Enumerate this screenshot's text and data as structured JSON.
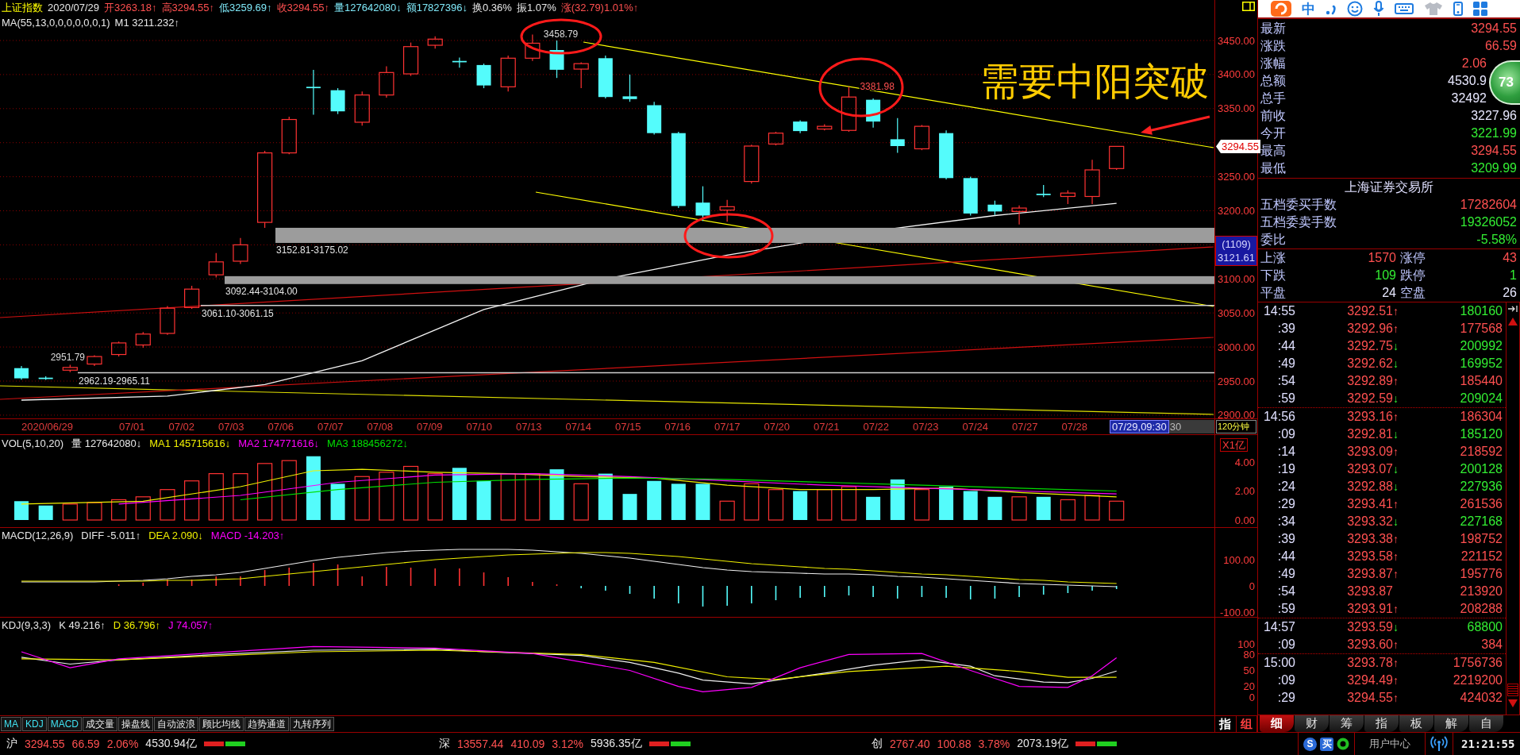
{
  "header": {
    "items": [
      {
        "text": "上证指数",
        "color": "#ffff00"
      },
      {
        "text": "2020/07/29",
        "color": "#e8e8e8"
      },
      {
        "text": "开3263.18↑",
        "color": "#ff5050"
      },
      {
        "text": "高3294.55↑",
        "color": "#ff5050"
      },
      {
        "text": "低3259.69↑",
        "color": "#7fe8f8"
      },
      {
        "text": "收3294.55↑",
        "color": "#ff5050"
      },
      {
        "text": "量127642080↓",
        "color": "#7fe8f8"
      },
      {
        "text": "额17827396↓",
        "color": "#7fe8f8"
      },
      {
        "text": "换0.36%",
        "color": "#e8e8e8"
      },
      {
        "text": "振1.07%",
        "color": "#e8e8e8"
      },
      {
        "text": "涨(32.79)1.01%↑",
        "color": "#ff5050"
      }
    ]
  },
  "main": {
    "indicator": [
      {
        "text": "MA(55,13,0,0,0,0,0,0,1)",
        "color": "#e8e8e8"
      },
      {
        "text": "M1 3211.232↑",
        "color": "#e8e8e8"
      }
    ],
    "levels": [
      {
        "kind": "zone",
        "label": "3152.81-3175.02"
      },
      {
        "kind": "zone",
        "label": "3092.44-3104.00"
      },
      {
        "kind": "line",
        "label": "3061.10-3061.15"
      },
      {
        "kind": "line",
        "label": "2962.19-2965.11"
      }
    ],
    "extremes": [
      {
        "kind": "high",
        "label": "3458.79",
        "color": "#dcdcdc"
      },
      {
        "kind": "high",
        "label": "3381.98",
        "color": "#ff5050"
      },
      {
        "kind": "low",
        "label": "2951.79",
        "color": "#dcdcdc"
      }
    ],
    "note": "需要中阳突破",
    "axis": {
      "ticks": [
        "3450.00",
        "3400.00",
        "3350.00",
        "3250.00",
        "3200.00",
        "3100.00",
        "3050.00",
        "3000.00",
        "2950.00",
        "2900.00"
      ],
      "price_tag": "3294.55",
      "cursor_count": "(1109)",
      "cursor_price": "3121.61"
    }
  },
  "date_axis": {
    "labels": [
      "2020/06/29",
      "07/01",
      "07/02",
      "07/03",
      "07/06",
      "07/07",
      "07/08",
      "07/09",
      "07/10",
      "07/13",
      "07/14",
      "07/15",
      "07/16",
      "07/17",
      "07/20",
      "07/21",
      "07/22",
      "07/23",
      "07/24",
      "07/27",
      "07/28"
    ],
    "cursor": "07/29,09:30",
    "cursor_tail": "30",
    "period": "120分钟"
  },
  "volume": {
    "indicator": [
      {
        "text": "VOL(5,10,20)",
        "color": "#e8e8e8"
      },
      {
        "text": "量 127642080↓",
        "color": "#e8e8e8"
      },
      {
        "text": "MA1 145715616↓",
        "color": "#f0f000"
      },
      {
        "text": "MA2 174771616↓",
        "color": "#ff00ff"
      },
      {
        "text": "MA3 188456272↓",
        "color": "#00e000"
      }
    ],
    "unit": "X1亿",
    "ticks": [
      "4.00",
      "2.00",
      "0.00"
    ]
  },
  "macd": {
    "indicator": [
      {
        "text": "MACD(12,26,9)",
        "color": "#e8e8e8"
      },
      {
        "text": "DIFF -5.011↑",
        "color": "#e8e8e8"
      },
      {
        "text": "DEA 2.090↓",
        "color": "#f0f000"
      },
      {
        "text": "MACD -14.203↑",
        "color": "#ff00ff"
      }
    ],
    "ticks": [
      "100.00",
      "0",
      "-100.00"
    ]
  },
  "kdj": {
    "indicator": [
      {
        "text": "KDJ(9,3,3)",
        "color": "#e8e8e8"
      },
      {
        "text": "K 49.216↑",
        "color": "#e8e8e8"
      },
      {
        "text": "D 36.796↑",
        "color": "#f0f000"
      },
      {
        "text": "J 74.057↑",
        "color": "#ff00ff"
      }
    ],
    "ticks": [
      "100",
      "80",
      "50",
      "20",
      "0"
    ]
  },
  "indicator_tabs": [
    {
      "label": "MA",
      "on": true
    },
    {
      "label": "KDJ",
      "on": true
    },
    {
      "label": "MACD",
      "on": true
    },
    {
      "label": "成交量",
      "on": false
    },
    {
      "label": "操盘线",
      "on": false
    },
    {
      "label": "自动波浪",
      "on": false
    },
    {
      "label": "顾比均线",
      "on": false
    },
    {
      "label": "趋势通道",
      "on": false
    },
    {
      "label": "九转序列",
      "on": false
    }
  ],
  "axis_buttons": [
    {
      "label": "指",
      "color": "#ffffff"
    },
    {
      "label": "组",
      "color": "#ff4040"
    }
  ],
  "input_toolbar": {
    "mode": "中"
  },
  "floating_ball": {
    "text": "73"
  },
  "quote": [
    {
      "label": "最新",
      "value": "3294.55",
      "color": "#ff5050"
    },
    {
      "label": "涨跌",
      "value": "66.59",
      "color": "#ff5050"
    },
    {
      "label": "涨幅",
      "value": "2.06",
      "color": "#ff5050"
    },
    {
      "label": "总额",
      "value": "4530.9",
      "color": "#e8e8ff"
    },
    {
      "label": "总手",
      "value": "32492",
      "color": "#e8e8ff"
    },
    {
      "label": "前收",
      "value": "3227.96",
      "color": "#e8e8ff"
    },
    {
      "label": "今开",
      "value": "3221.99",
      "color": "#33ee33"
    },
    {
      "label": "最高",
      "value": "3294.55",
      "color": "#ff5050"
    },
    {
      "label": "最低",
      "value": "3209.99",
      "color": "#33ee33"
    }
  ],
  "exchange": {
    "title": "上海证券交易所",
    "rows": [
      {
        "label": "五档委买手数",
        "value": "17282604",
        "color": "#ff5050"
      },
      {
        "label": "五档委卖手数",
        "value": "19326052",
        "color": "#33ee33"
      },
      {
        "label": "委比",
        "value": "-5.58%",
        "color": "#33ee33"
      }
    ]
  },
  "breadth": [
    {
      "label": "上涨",
      "count": "1570",
      "limit_label": "涨停",
      "limit_count": "43",
      "color": "#ff5050"
    },
    {
      "label": "下跌",
      "count": "109",
      "limit_label": "跌停",
      "limit_count": "1",
      "color": "#33ee33"
    },
    {
      "label": "平盘",
      "count": "24",
      "limit_label": "空盘",
      "limit_count": "26",
      "color": "#e8e8ff"
    }
  ],
  "tick_groups": [
    {
      "rows": [
        {
          "time": "14:55",
          "price": "3292.51",
          "arrow": "↑",
          "falling": false,
          "volume": "180160",
          "color": "#33ee33"
        },
        {
          "time": ":39",
          "price": "3292.96",
          "arrow": "↑",
          "falling": false,
          "volume": "177568",
          "color": "#ff5050"
        },
        {
          "time": ":44",
          "price": "3292.75",
          "arrow": "↓",
          "falling": true,
          "volume": "200992",
          "color": "#33ee33"
        },
        {
          "time": ":49",
          "price": "3292.62",
          "arrow": "↓",
          "falling": true,
          "volume": "169952",
          "color": "#33ee33"
        },
        {
          "time": ":54",
          "price": "3292.89",
          "arrow": "↑",
          "falling": false,
          "volume": "185440",
          "color": "#ff5050"
        },
        {
          "time": ":59",
          "price": "3292.59",
          "arrow": "↓",
          "falling": true,
          "volume": "209024",
          "color": "#33ee33"
        }
      ]
    },
    {
      "rows": [
        {
          "time": "14:56",
          "price": "3293.16",
          "arrow": "↑",
          "falling": false,
          "volume": "186304",
          "color": "#ff5050"
        },
        {
          "time": ":09",
          "price": "3292.81",
          "arrow": "↓",
          "falling": true,
          "volume": "185120",
          "color": "#33ee33"
        },
        {
          "time": ":14",
          "price": "3293.09",
          "arrow": "↑",
          "falling": false,
          "volume": "218592",
          "color": "#ff5050"
        },
        {
          "time": ":19",
          "price": "3293.07",
          "arrow": "↓",
          "falling": true,
          "volume": "200128",
          "color": "#33ee33"
        },
        {
          "time": ":24",
          "price": "3292.88",
          "arrow": "↓",
          "falling": true,
          "volume": "227936",
          "color": "#33ee33"
        },
        {
          "time": ":29",
          "price": "3293.41",
          "arrow": "↑",
          "falling": false,
          "volume": "261536",
          "color": "#ff5050"
        },
        {
          "time": ":34",
          "price": "3293.32",
          "arrow": "↓",
          "falling": true,
          "volume": "227168",
          "color": "#33ee33"
        },
        {
          "time": ":39",
          "price": "3293.38",
          "arrow": "↑",
          "falling": false,
          "volume": "198752",
          "color": "#ff5050"
        },
        {
          "time": ":44",
          "price": "3293.58",
          "arrow": "↑",
          "falling": false,
          "volume": "221152",
          "color": "#ff5050"
        },
        {
          "time": ":49",
          "price": "3293.87",
          "arrow": "↑",
          "falling": false,
          "volume": "195776",
          "color": "#ff5050"
        },
        {
          "time": ":54",
          "price": "3293.87",
          "volume": "213920",
          "color": "#ff5050"
        },
        {
          "time": ":59",
          "price": "3293.91",
          "arrow": "↑",
          "falling": false,
          "volume": "208288",
          "color": "#ff5050"
        }
      ]
    },
    {
      "rows": [
        {
          "time": "14:57",
          "price": "3293.59",
          "arrow": "↓",
          "falling": true,
          "volume": "68800",
          "color": "#33ee33"
        },
        {
          "time": ":09",
          "price": "3293.60",
          "arrow": "↑",
          "falling": false,
          "volume": "384",
          "color": "#ff5050"
        }
      ]
    },
    {
      "rows": [
        {
          "time": "15:00",
          "price": "3293.78",
          "arrow": "↑",
          "falling": false,
          "volume": "1756736",
          "color": "#ff5050"
        },
        {
          "time": ":09",
          "price": "3294.49",
          "arrow": "↑",
          "falling": false,
          "volume": "2219200",
          "color": "#ff5050"
        },
        {
          "time": ":29",
          "price": "3294.55",
          "arrow": "↑",
          "falling": false,
          "volume": "424032",
          "color": "#ff5050"
        }
      ]
    }
  ],
  "panel_tabs": [
    {
      "label": "细",
      "selected": true
    },
    {
      "label": "财",
      "selected": false
    },
    {
      "label": "筹",
      "selected": false
    },
    {
      "label": "指",
      "selected": false
    },
    {
      "label": "板",
      "selected": false
    },
    {
      "label": "解",
      "selected": false
    },
    {
      "label": "自",
      "selected": false
    }
  ],
  "status_bar": {
    "markets": [
      {
        "name": "沪",
        "price": "3294.55",
        "change": "66.59",
        "percent": "2.06%",
        "amount": "4530.94亿"
      },
      {
        "name": "深",
        "price": "13557.44",
        "change": "410.09",
        "percent": "3.12%",
        "amount": "5936.35亿"
      },
      {
        "name": "创",
        "price": "2767.40",
        "change": "100.88",
        "percent": "3.78%",
        "amount": "2073.19亿"
      }
    ],
    "tray": [
      {
        "kind": "circle",
        "text": "S"
      },
      {
        "kind": "square",
        "text": "买"
      }
    ],
    "user_center": "用户中心",
    "time": "21:21:55"
  }
}
